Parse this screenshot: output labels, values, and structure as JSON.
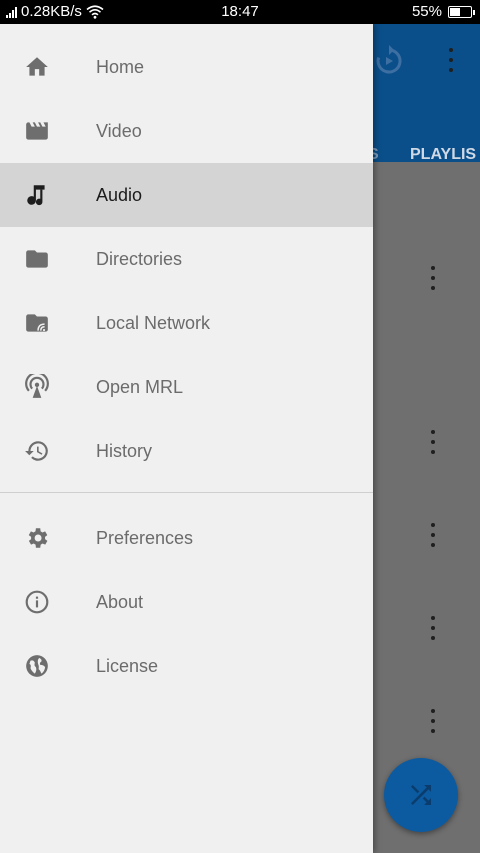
{
  "status_bar": {
    "network_speed": "0.28KB/s",
    "time": "18:47",
    "battery": "55%",
    "battery_level": 0.55
  },
  "background": {
    "tab_partial_left": "S",
    "tab_playlists_partial": "PLAYLIS",
    "icons": [
      "replay-icon",
      "more-vert-icon",
      "shuffle-icon"
    ]
  },
  "drawer": {
    "main_items": [
      {
        "label": "Home",
        "icon": "home-icon"
      },
      {
        "label": "Video",
        "icon": "movie-icon"
      },
      {
        "label": "Audio",
        "icon": "music-note-icon",
        "active": true
      },
      {
        "label": "Directories",
        "icon": "folder-icon"
      },
      {
        "label": "Local Network",
        "icon": "network-folder-icon"
      },
      {
        "label": "Open MRL",
        "icon": "antenna-icon"
      },
      {
        "label": "History",
        "icon": "history-icon"
      }
    ],
    "secondary_items": [
      {
        "label": "Preferences",
        "icon": "gear-icon"
      },
      {
        "label": "About",
        "icon": "info-icon"
      },
      {
        "label": "License",
        "icon": "globe-icon"
      }
    ]
  }
}
